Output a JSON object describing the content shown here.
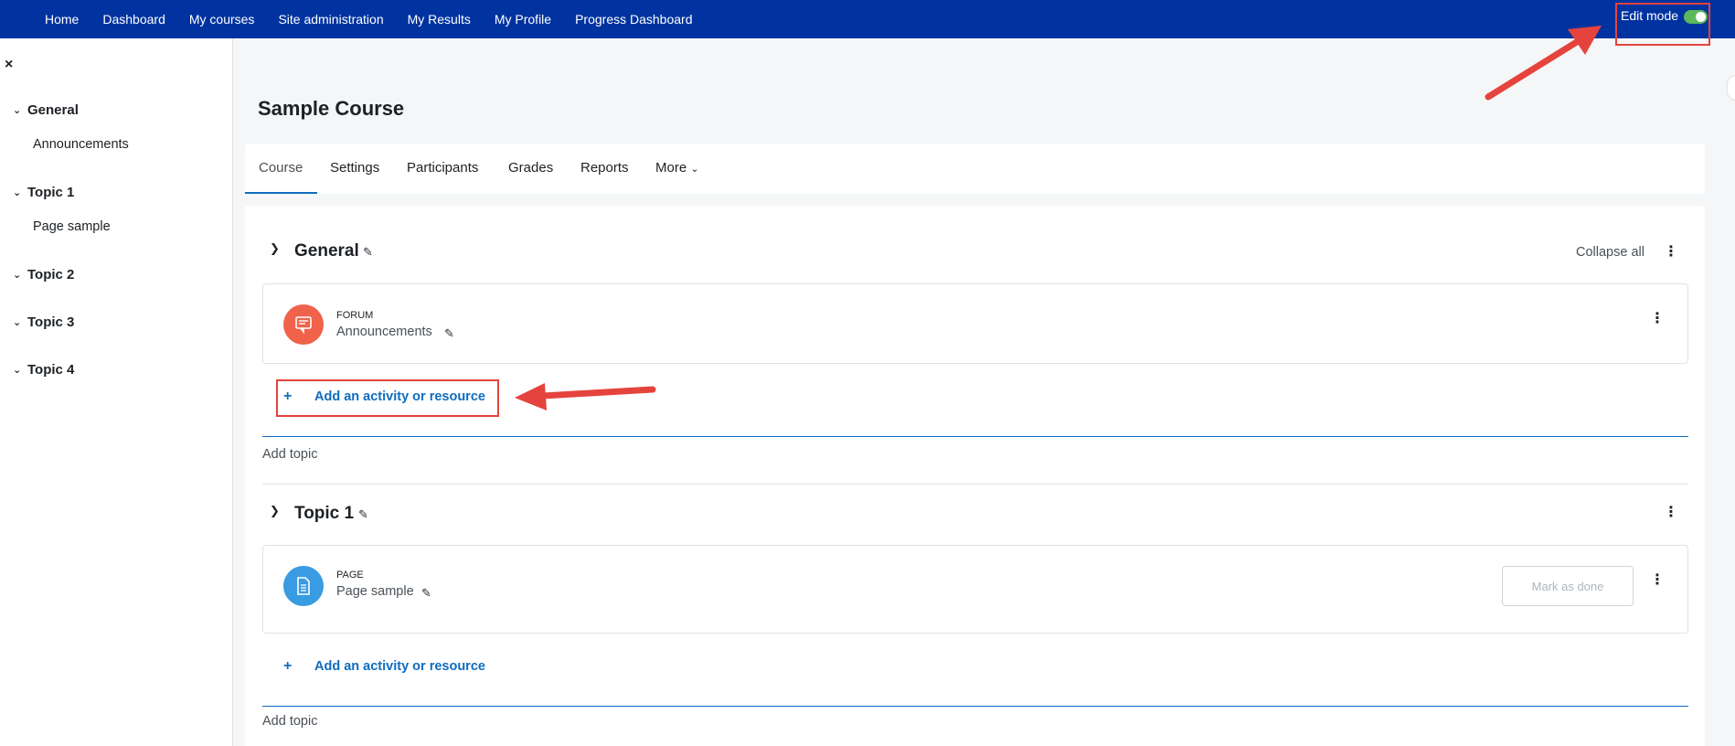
{
  "navbar": {
    "links": [
      "Home",
      "Dashboard",
      "My courses",
      "Site administration",
      "My Results",
      "My Profile",
      "Progress Dashboard"
    ],
    "edit_mode_label": "Edit mode",
    "edit_mode_on": true
  },
  "drawer": {
    "close_icon": "×",
    "sections": [
      {
        "label": "General",
        "items": [
          "Announcements"
        ]
      },
      {
        "label": "Topic 1",
        "items": [
          "Page sample"
        ]
      },
      {
        "label": "Topic 2",
        "items": []
      },
      {
        "label": "Topic 3",
        "items": []
      },
      {
        "label": "Topic 4",
        "items": []
      }
    ]
  },
  "course": {
    "title": "Sample Course",
    "tabs": [
      "Course",
      "Settings",
      "Participants",
      "Grades",
      "Reports",
      "More"
    ],
    "collapse_all": "Collapse all",
    "sections": [
      {
        "title": "General",
        "activity": {
          "type": "FORUM",
          "name": "Announcements"
        },
        "add_activity": "Add an activity or resource",
        "add_topic": "Add topic"
      },
      {
        "title": "Topic 1",
        "activity": {
          "type": "PAGE",
          "name": "Page sample",
          "button": "Mark as done"
        },
        "add_activity": "Add an activity or resource",
        "add_topic": "Add topic"
      }
    ]
  },
  "colors": {
    "navbar": "#0033a0",
    "forum_icon": "#f0624a",
    "page_icon": "#399be2",
    "link": "#0f6cbf",
    "annotation": "#e5433d"
  }
}
